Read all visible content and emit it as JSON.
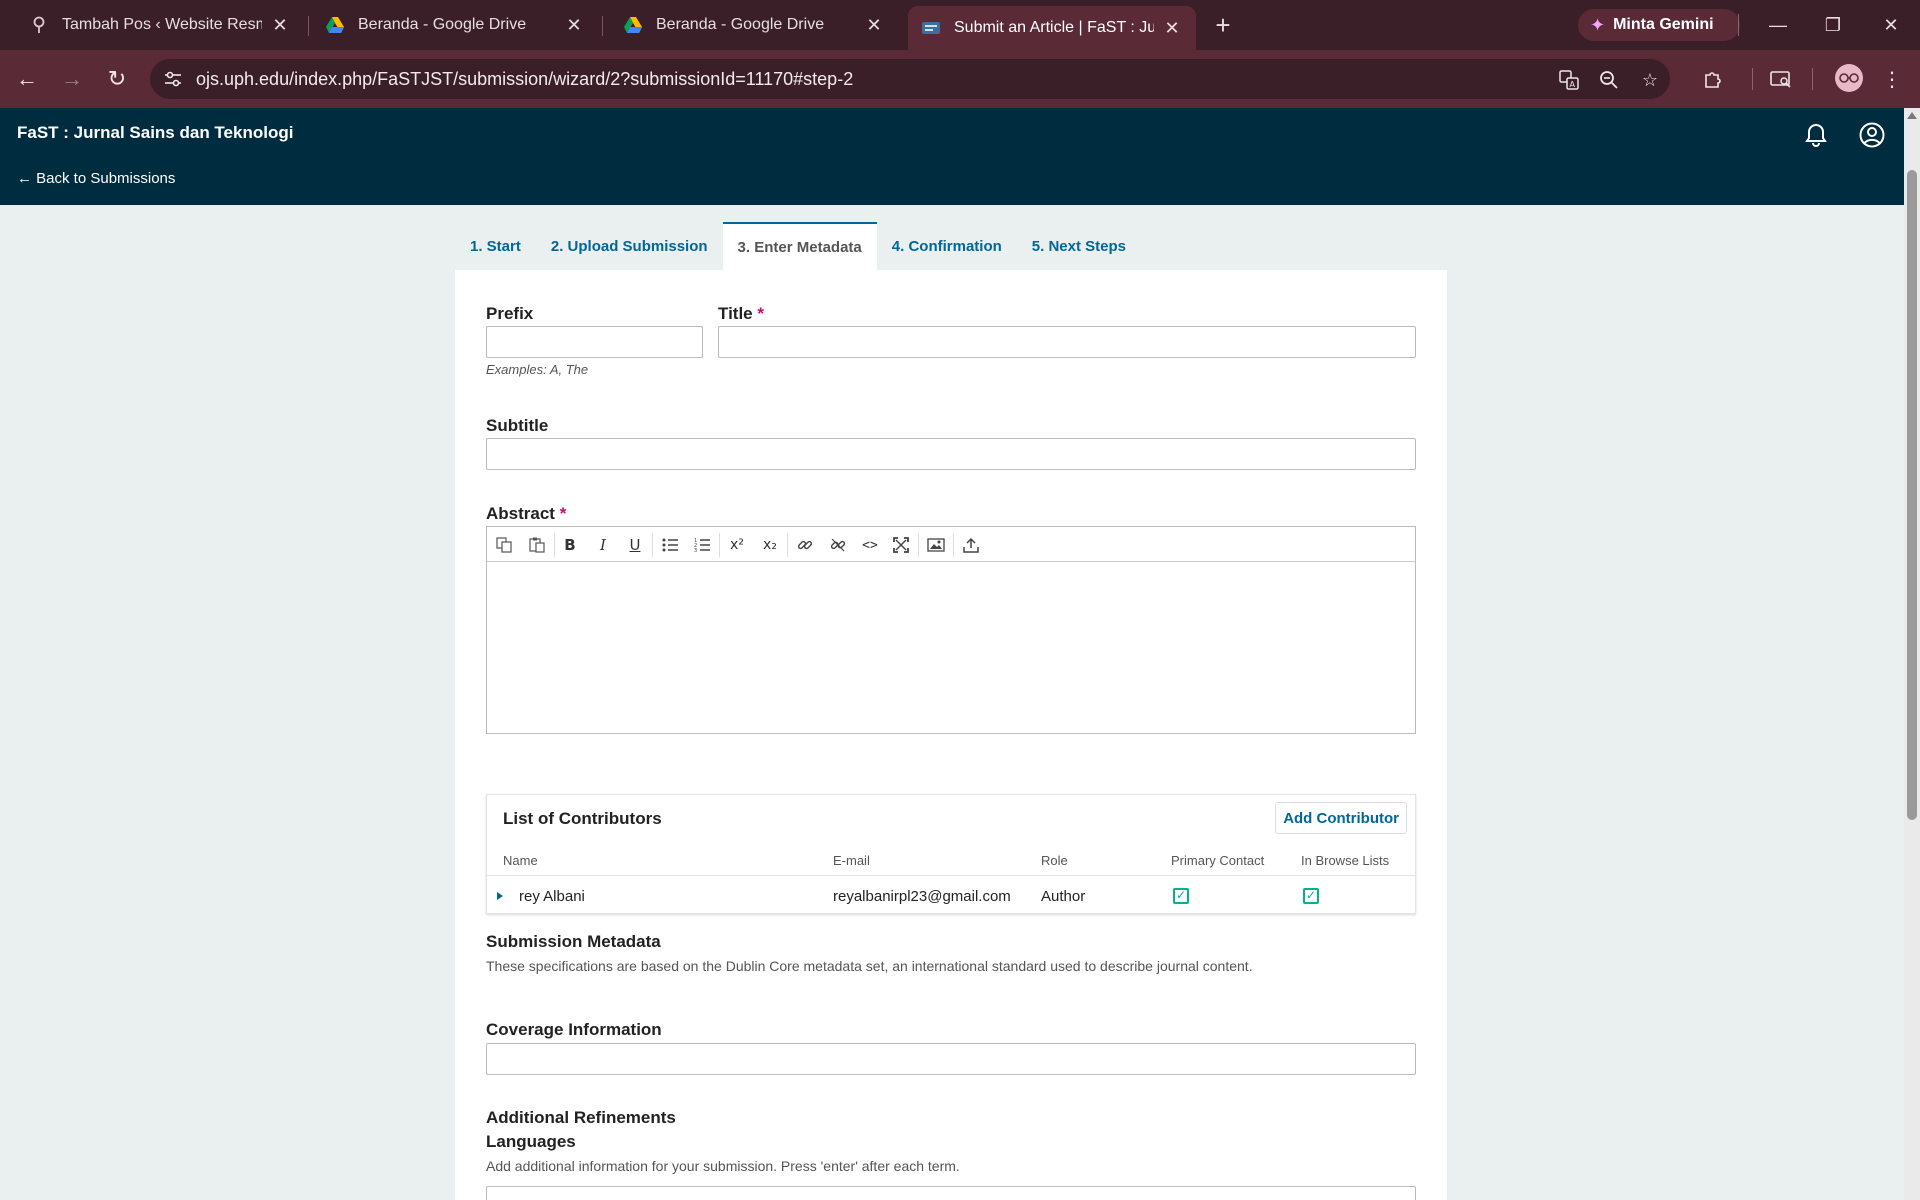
{
  "browser": {
    "tabs": [
      {
        "title": "Tambah Pos ‹ Website Resmi PT",
        "icon": "pin-icon"
      },
      {
        "title": "Beranda - Google Drive",
        "icon": "google-drive-icon"
      },
      {
        "title": "Beranda - Google Drive",
        "icon": "google-drive-icon"
      },
      {
        "title": "Submit an Article | FaST : Jurnal",
        "icon": "ojs-favicon",
        "active": true
      }
    ],
    "gemini_label": "Minta Gemini",
    "url": "ojs.uph.edu/index.php/FaSTJST/submission/wizard/2?submissionId=11170#step-2"
  },
  "header": {
    "journal_name": "FaST : Jurnal Sains dan Teknologi",
    "back_link": "← Back to Submissions"
  },
  "wizard": {
    "steps": [
      "1. Start",
      "2. Upload Submission",
      "3. Enter Metadata",
      "4. Confirmation",
      "5. Next Steps"
    ],
    "active_step": 2
  },
  "form": {
    "prefix_label": "Prefix",
    "prefix_hint": "Examples: A, The",
    "title_label": "Title",
    "required_mark": "*",
    "subtitle_label": "Subtitle",
    "abstract_label": "Abstract",
    "coverage_label": "Coverage Information",
    "additional_label": "Additional Refinements",
    "languages_label": "Languages",
    "languages_desc": "Add additional information for your submission. Press 'enter' after each term."
  },
  "contributors": {
    "title": "List of Contributors",
    "add_button": "Add Contributor",
    "columns": [
      "Name",
      "E-mail",
      "Role",
      "Primary Contact",
      "In Browse Lists"
    ],
    "rows": [
      {
        "name": "rey Albani",
        "email": "reyalbanirpl23@gmail.com",
        "role": "Author",
        "primary_contact": true,
        "in_browse_lists": true
      }
    ]
  },
  "metadata": {
    "title": "Submission Metadata",
    "description": "These specifications are based on the Dublin Core metadata set, an international standard used to describe journal content."
  },
  "colors": {
    "header_bg": "#002c3f",
    "link": "#006798",
    "required": "#d00a6c",
    "check": "#00b28e",
    "browser_frame": "#3a1f28"
  }
}
